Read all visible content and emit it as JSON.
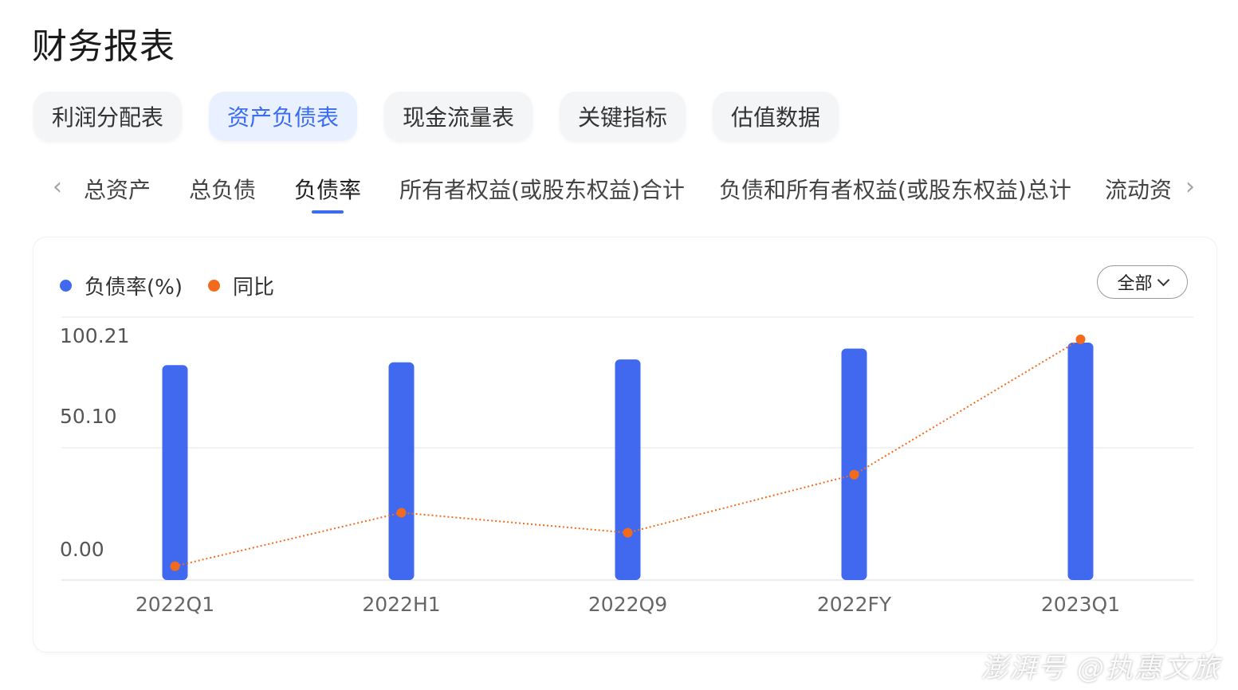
{
  "page": {
    "title": "财务报表"
  },
  "report_tabs": [
    {
      "label": "利润分配表",
      "active": false
    },
    {
      "label": "资产负债表",
      "active": true
    },
    {
      "label": "现金流量表",
      "active": false
    },
    {
      "label": "关键指标",
      "active": false
    },
    {
      "label": "估值数据",
      "active": false
    }
  ],
  "metric_tabs": [
    {
      "label": "总资产",
      "active": false
    },
    {
      "label": "总负债",
      "active": false
    },
    {
      "label": "负债率",
      "active": true
    },
    {
      "label": "所有者权益(或股东权益)合计",
      "active": false
    },
    {
      "label": "负债和所有者权益(或股东权益)总计",
      "active": false
    },
    {
      "label": "流动资",
      "active": false
    }
  ],
  "arrows": {
    "prev_icon": "chevron-left-icon",
    "next_icon": "chevron-right-icon"
  },
  "range_select": {
    "value": "全部",
    "icon": "chevron-down-icon"
  },
  "colors": {
    "accent": "#3b6cf0",
    "bar": "#4169f0",
    "line": "#f26b1d"
  },
  "watermark": "澎湃号 @执惠文旅",
  "chart_data": {
    "type": "bar",
    "categories": [
      "2022Q1",
      "2022H1",
      "2022Q9",
      "2022FY",
      "2023Q1"
    ],
    "y_ticks": [
      "100.21",
      "50.10",
      "0.00"
    ],
    "y_tick_values": [
      100.21,
      50.1,
      0
    ],
    "ylim": [
      0,
      100.21
    ],
    "grid": true,
    "legend_position": "top-left",
    "series": [
      {
        "name": "负债率(%)",
        "type": "bar",
        "color": "#4169f0",
        "values": [
          90.7,
          91.9,
          93.1,
          97.7,
          100.2
        ]
      },
      {
        "name": "同比",
        "type": "line",
        "style": "dotted",
        "color": "#f26b1d",
        "values": [
          0.8,
          23.5,
          15.0,
          39.6,
          97.0
        ],
        "axis_max": 100
      }
    ]
  }
}
